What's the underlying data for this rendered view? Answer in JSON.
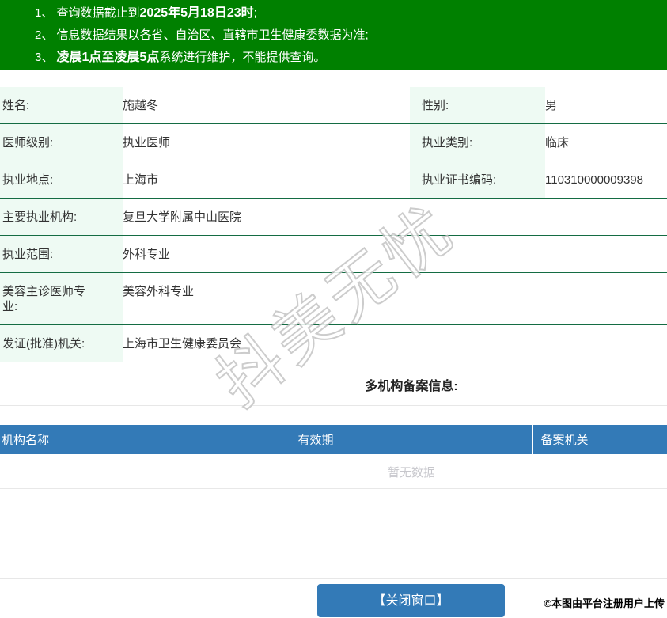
{
  "colors": {
    "banner_green": "#008000",
    "table_border_green": "#146c43",
    "label_bg": "#eefaf3",
    "header_blue": "#337ab7",
    "button_blue": "#337ab7"
  },
  "notice": {
    "n1": "1、",
    "l1_pre": "查询数据截止到",
    "l1_bold": "2025年5月18日23时",
    "l1_post": ";",
    "n2": "2、",
    "l2": "信息数据结果以各省、自治区、直辖市卫生健康委数据为准;",
    "n3": "3、",
    "l3_bold": "凌晨1点至凌晨5点",
    "l3_post": "系统进行维护，不能提供查询。"
  },
  "profile": {
    "rows2col": [
      {
        "label1": "姓名:",
        "value1": "施越冬",
        "label2": "性别:",
        "value2": "男"
      },
      {
        "label1": "医师级别:",
        "value1": "执业医师",
        "label2": "执业类别:",
        "value2": "临床"
      },
      {
        "label1": "执业地点:",
        "value1": "上海市",
        "label2": "执业证书编码:",
        "value2": "110310000009398"
      }
    ],
    "rows1col": [
      {
        "label": "主要执业机构:",
        "value": "复旦大学附属中山医院"
      },
      {
        "label": "执业范围:",
        "value": "外科专业"
      },
      {
        "label": "美容主诊医师专业:",
        "value": "美容外科专业"
      },
      {
        "label": "发证(批准)机关:",
        "value": "上海市卫生健康委员会"
      }
    ]
  },
  "filing": {
    "title": "多机构备案信息:",
    "columns": [
      "机构名称",
      "有效期",
      "备案机关"
    ],
    "empty": "暂无数据"
  },
  "footer": {
    "close_button": "【关闭窗口】",
    "copyright": "©本图由平台注册用户上传"
  },
  "watermark": {
    "text": "抖美无忧"
  }
}
